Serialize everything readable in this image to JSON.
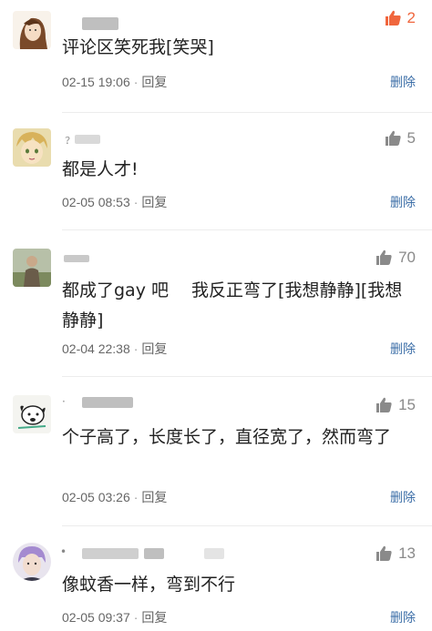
{
  "comments": [
    {
      "text": "评论区笑死我[笑哭]",
      "date": "02-15 19:06",
      "reply": "回复",
      "delete": "删除",
      "likes": "2",
      "liked": true,
      "avatar_icon": "avatar-girl-sketch-icon"
    },
    {
      "text": "都是人才!",
      "date": "02-05 08:53",
      "reply": "回复",
      "delete": "删除",
      "likes": "5",
      "liked": false,
      "avatar_icon": "avatar-anime-boy-icon"
    },
    {
      "text": "都成了gay 吧　 我反正弯了[我想静静][我想静静]",
      "date": "02-04 22:38",
      "reply": "回复",
      "delete": "删除",
      "likes": "70",
      "liked": false,
      "avatar_icon": "avatar-photo-person-icon"
    },
    {
      "text": "个子高了，长度长了，直径宽了，然而弯了",
      "date": "02-05 03:26",
      "reply": "回复",
      "delete": "删除",
      "likes": "15",
      "liked": false,
      "avatar_icon": "avatar-cartoon-dog-icon"
    },
    {
      "text": "像蚊香一样，弯到不行",
      "date": "02-05 09:37",
      "reply": "回复",
      "delete": "删除",
      "likes": "13",
      "liked": false,
      "avatar_icon": "avatar-purple-hair-icon"
    }
  ],
  "colors": {
    "like_active": "#f0663d",
    "like_inactive": "#8a8a8a",
    "delete_link": "#3d6fa8"
  },
  "icons": {
    "thumbs_up": "thumbs-up-icon"
  }
}
